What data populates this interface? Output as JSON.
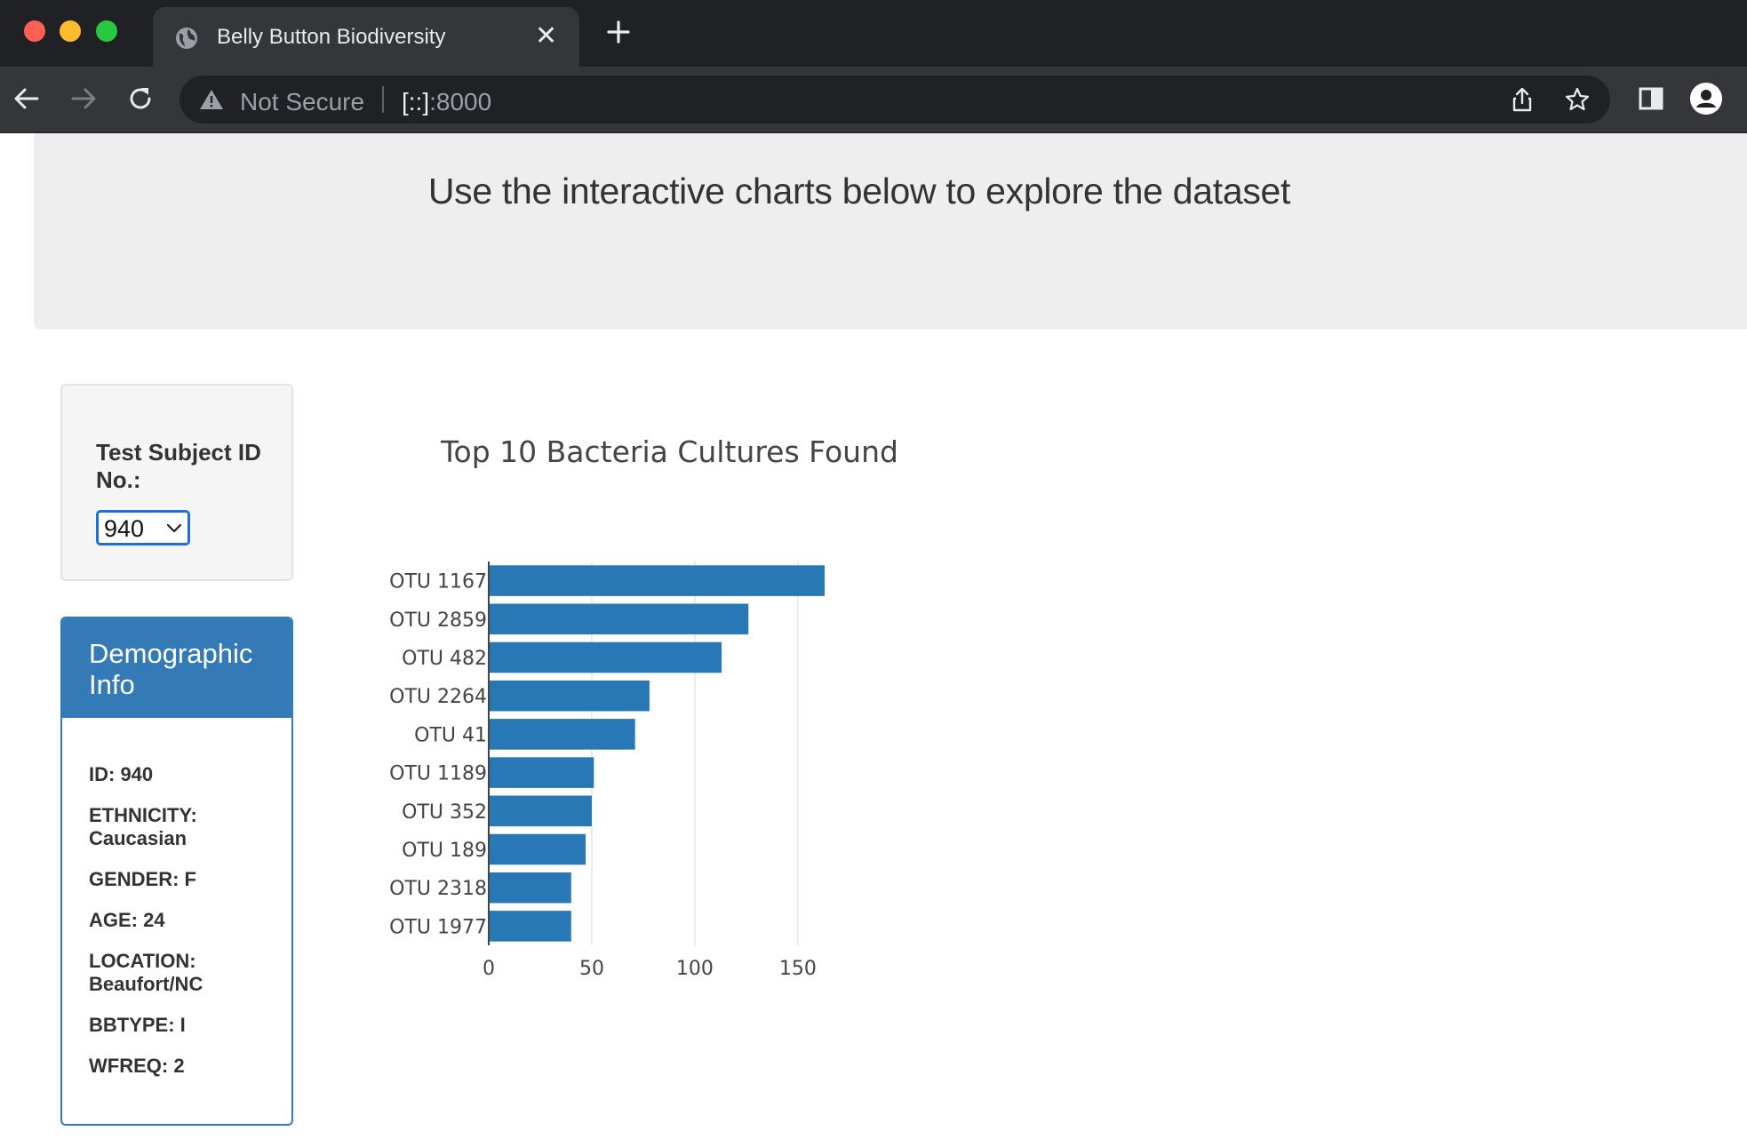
{
  "browser": {
    "tab_title": "Belly Button Biodiversity",
    "tab_close": "✕",
    "security_label": "Not Secure",
    "url_host": "[::]",
    "url_port": ":8000"
  },
  "page": {
    "jumbotron_text": "Use the interactive charts below to explore the dataset"
  },
  "selector": {
    "label": "Test Subject ID No.:",
    "selected_value": "940"
  },
  "demographics": {
    "title": "Demographic Info",
    "lines": [
      "ID: 940",
      "ETHNICITY: Caucasian",
      "GENDER: F",
      "AGE: 24",
      "LOCATION: Beaufort/NC",
      "BBTYPE: I",
      "WFREQ: 2"
    ]
  },
  "colors": {
    "bar": "#2878b5",
    "panel": "#337ab7",
    "jumbotron": "#eeeeee"
  },
  "chart_data": {
    "type": "bar",
    "orientation": "horizontal",
    "title": "Top 10 Bacteria Cultures Found",
    "categories": [
      "OTU 1167",
      "OTU 2859",
      "OTU 482",
      "OTU 2264",
      "OTU 41",
      "OTU 1189",
      "OTU 352",
      "OTU 189",
      "OTU 2318",
      "OTU 1977"
    ],
    "values": [
      163,
      126,
      113,
      78,
      71,
      51,
      50,
      47,
      40,
      40
    ],
    "xticks": [
      0,
      50,
      100,
      150
    ],
    "xlim": [
      0,
      171.6
    ],
    "grid": true
  }
}
